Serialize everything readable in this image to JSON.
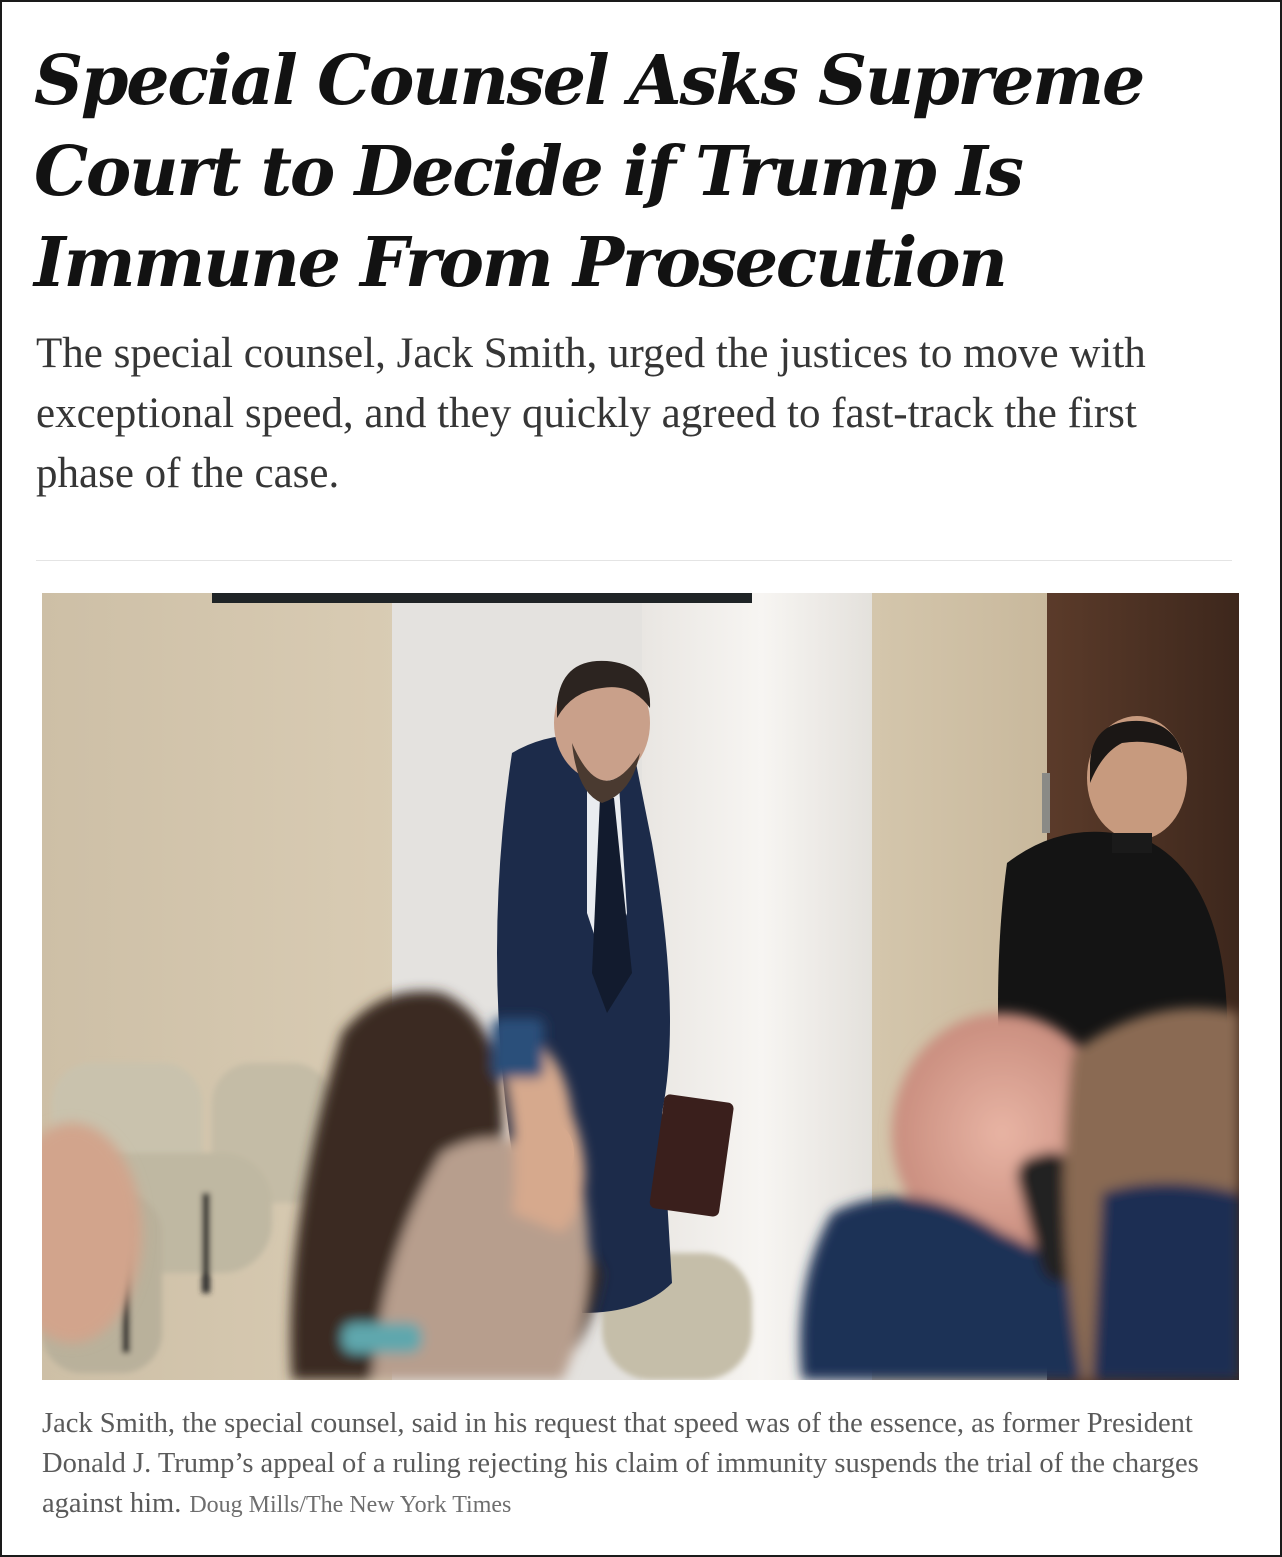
{
  "article": {
    "headline": "Special Counsel Asks Supreme Court to Decide if Trump Is Immune From Prosecution",
    "summary": "The special counsel, Jack Smith, urged the justices to move with exceptional speed, and they quickly agreed to fast-track the first phase of the case.",
    "photo": {
      "caption": "Jack Smith, the special counsel, said in his request that speed was of the essence, as former President Donald J. Trump’s appeal of a ruling rejecting his claim of immunity suspends the trial of the charges against him.",
      "credit": "Doug Mills/The New York Times"
    }
  }
}
